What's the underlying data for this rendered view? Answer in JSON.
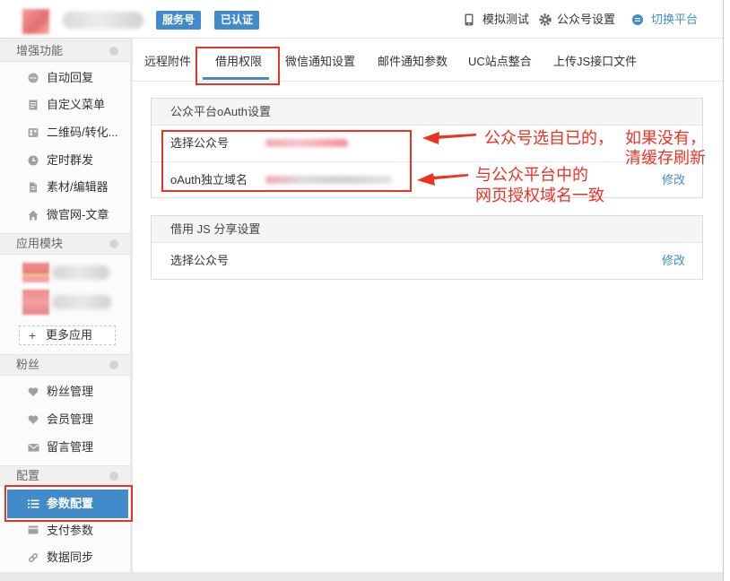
{
  "header": {
    "badges": {
      "type": "服务号",
      "verified": "已认证"
    },
    "actions": {
      "simulate": {
        "label": "模拟测试",
        "icon": "phone-icon"
      },
      "account_settings": {
        "label": "公众号设置",
        "icon": "gear-icon"
      },
      "switch_platform": {
        "label": "切换平台",
        "icon": "switch-icon"
      }
    }
  },
  "sidebar": {
    "sections": [
      {
        "title": "增强功能",
        "items": [
          {
            "label": "自动回复",
            "icon": "chat-bubble-icon"
          },
          {
            "label": "自定义菜单",
            "icon": "menu-document-icon"
          },
          {
            "label": "二维码/转化...",
            "icon": "qrcode-icon"
          },
          {
            "label": "定时群发",
            "icon": "clock-icon"
          },
          {
            "label": "素材/编辑器",
            "icon": "document-icon"
          },
          {
            "label": "微官网-文章",
            "icon": "home-icon"
          }
        ]
      },
      {
        "title": "应用模块",
        "more_apps": {
          "icon_glyph": "+",
          "label": "更多应用"
        }
      },
      {
        "title": "粉丝",
        "items": [
          {
            "label": "粉丝管理",
            "icon": "heart-icon"
          },
          {
            "label": "会员管理",
            "icon": "heart-icon"
          },
          {
            "label": "留言管理",
            "icon": "envelope-icon"
          }
        ]
      },
      {
        "title": "配置",
        "items": [
          {
            "label": "参数配置",
            "icon": "list-icon",
            "active": true
          },
          {
            "label": "支付参数",
            "icon": "card-icon"
          },
          {
            "label": "数据同步",
            "icon": "link-icon"
          }
        ]
      }
    ]
  },
  "tabs": [
    {
      "label": "远程附件"
    },
    {
      "label": "借用权限",
      "active": true
    },
    {
      "label": "微信通知设置"
    },
    {
      "label": "邮件通知参数"
    },
    {
      "label": "UC站点整合"
    },
    {
      "label": "上传JS接口文件"
    }
  ],
  "panels": {
    "oauth": {
      "title": "公众平台oAuth设置",
      "rows": [
        {
          "label": "选择公众号"
        },
        {
          "label": "oAuth独立域名",
          "action": "修改"
        }
      ]
    },
    "js_share": {
      "title": "借用 JS 分享设置",
      "rows": [
        {
          "label": "选择公众号",
          "action": "修改"
        }
      ]
    }
  },
  "annotations": {
    "note1": {
      "line1_start": "公众号选自已的，",
      "line1_end": "如果没有，",
      "line2": "清缓存刷新"
    },
    "note2": {
      "line1": "与公众平台中的",
      "line2": "网页授权域名一致"
    }
  },
  "colors": {
    "accent": "#428bca",
    "annotation_red": "#ea3323",
    "header_link": "#428bca"
  }
}
